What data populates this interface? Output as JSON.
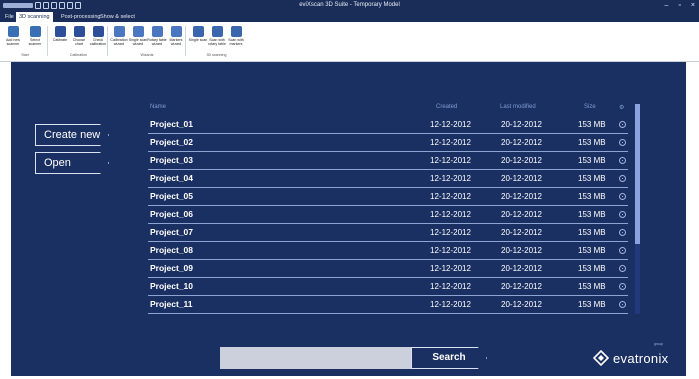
{
  "window": {
    "title": "eviXscan 3D Suite - Temporary Model",
    "controls": {
      "minimize": "–",
      "maximize": "▫",
      "close": "×"
    }
  },
  "ribbon": {
    "tabs": [
      {
        "label": "File"
      },
      {
        "label": "3D scanning"
      },
      {
        "label": "Post-processing"
      },
      {
        "label": "Show & select"
      }
    ],
    "buttons": [
      {
        "label": "Add new scanner",
        "icon": "scanner-icon"
      },
      {
        "label": "Select scanner",
        "icon": "scanner-select-icon"
      },
      {
        "label": "Calibrate",
        "icon": "calibrate-grid-icon"
      },
      {
        "label": "Choose chart",
        "icon": "chart-grid-icon"
      },
      {
        "label": "Check calibration",
        "icon": "check-calibration-icon"
      },
      {
        "label": "Calibration wizard",
        "icon": "calibration-wizard-icon"
      },
      {
        "label": "Single scan wizard",
        "icon": "single-scan-wizard-icon"
      },
      {
        "label": "Rotary table wizard",
        "icon": "rotary-table-wizard-icon"
      },
      {
        "label": "Markers wizard",
        "icon": "markers-wizard-icon"
      },
      {
        "label": "Single scan",
        "icon": "single-scan-icon"
      },
      {
        "label": "Scan with rotary table",
        "icon": "rotary-scan-icon"
      },
      {
        "label": "Scan with markers",
        "icon": "markers-scan-icon"
      }
    ],
    "groups": [
      {
        "label": "Start"
      },
      {
        "label": "Calibration"
      },
      {
        "label": "Wizards"
      },
      {
        "label": "3D scanning"
      }
    ]
  },
  "actions": {
    "create_new": "Create new",
    "open": "Open"
  },
  "table": {
    "columns": {
      "name": "Name",
      "created": "Created",
      "modified": "Last modified",
      "size": "Size"
    },
    "rows": [
      {
        "name": "Project_01",
        "created": "12-12-2012",
        "modified": "20-12-2012",
        "size": "153 MB"
      },
      {
        "name": "Project_02",
        "created": "12-12-2012",
        "modified": "20-12-2012",
        "size": "153 MB"
      },
      {
        "name": "Project_03",
        "created": "12-12-2012",
        "modified": "20-12-2012",
        "size": "153 MB"
      },
      {
        "name": "Project_04",
        "created": "12-12-2012",
        "modified": "20-12-2012",
        "size": "153 MB"
      },
      {
        "name": "Project_05",
        "created": "12-12-2012",
        "modified": "20-12-2012",
        "size": "153 MB"
      },
      {
        "name": "Project_06",
        "created": "12-12-2012",
        "modified": "20-12-2012",
        "size": "153 MB"
      },
      {
        "name": "Project_07",
        "created": "12-12-2012",
        "modified": "20-12-2012",
        "size": "153 MB"
      },
      {
        "name": "Project_08",
        "created": "12-12-2012",
        "modified": "20-12-2012",
        "size": "153 MB"
      },
      {
        "name": "Project_09",
        "created": "12-12-2012",
        "modified": "20-12-2012",
        "size": "153 MB"
      },
      {
        "name": "Project_10",
        "created": "12-12-2012",
        "modified": "20-12-2012",
        "size": "153 MB"
      },
      {
        "name": "Project_11",
        "created": "12-12-2012",
        "modified": "20-12-2012",
        "size": "153 MB"
      }
    ]
  },
  "search": {
    "placeholder": "",
    "value": "",
    "button_label": "Search"
  },
  "brand": {
    "name": "evatronix",
    "tagline": "group"
  },
  "colors": {
    "main_bg": "#1b3062",
    "titlebar_bg": "#1a2d59",
    "row_divider": "#8ea5d3",
    "header_text": "#7e9cd6",
    "search_field": "#ccd0dd"
  }
}
